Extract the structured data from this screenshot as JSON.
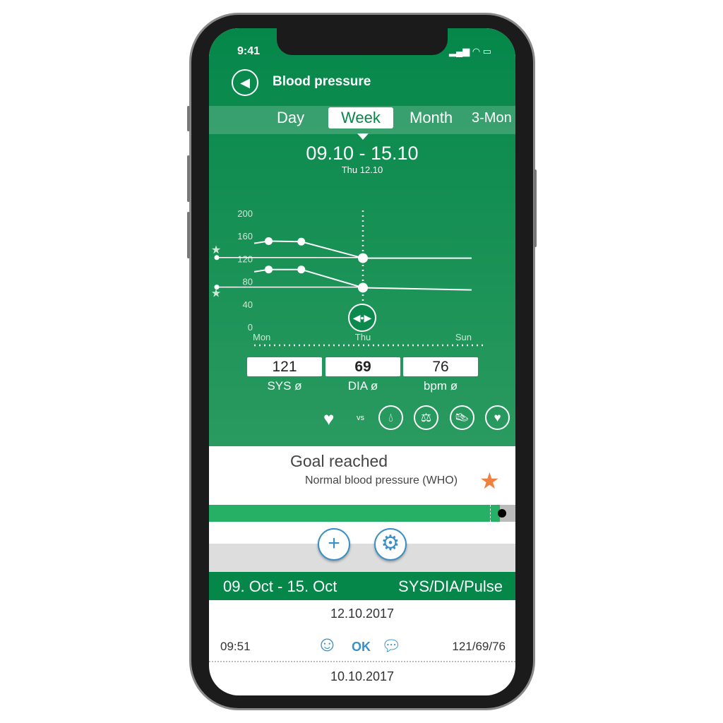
{
  "status": {
    "time": "9:41"
  },
  "header": {
    "title": "Blood pressure"
  },
  "tabs": [
    {
      "label": "Day"
    },
    {
      "label": "Week",
      "active": true
    },
    {
      "label": "Month"
    },
    {
      "label": "3-Mon"
    }
  ],
  "range": {
    "title": "09.10 - 15.10",
    "selected": "Thu 12.10"
  },
  "chart_data": {
    "type": "line",
    "x_labels": [
      "Mon",
      "Thu",
      "Sun"
    ],
    "y_ticks": [
      0,
      40,
      80,
      120,
      160,
      200
    ],
    "ylim": [
      0,
      200
    ],
    "xlim": [
      0,
      6
    ],
    "series": [
      {
        "x": [
          0,
          0.4,
          1.3,
          3,
          6
        ],
        "values": [
          147,
          151,
          150,
          121,
          121
        ]
      },
      {
        "x": [
          0,
          0.4,
          1.3,
          3,
          6
        ],
        "values": [
          97,
          101,
          101,
          69,
          65
        ]
      }
    ],
    "goal_lines": [
      122,
      70
    ]
  },
  "averages": [
    {
      "value": "121",
      "label": "SYS ø"
    },
    {
      "value": "69",
      "label": "DIA ø"
    },
    {
      "value": "76",
      "label": "bpm ø"
    }
  ],
  "compare": {
    "vs": "vs",
    "icons": [
      "heart-pulse-icon",
      "drop-icon",
      "scale-icon",
      "shoe-icon",
      "heart-icon"
    ]
  },
  "goal": {
    "title": "Goal reached",
    "subtitle": "Normal blood pressure (WHO)",
    "progress": 0.95,
    "bar_color": "#25b066"
  },
  "list": {
    "range": "09. Oct - 15. Oct",
    "columns": "SYS/DIA/Pulse",
    "entries": [
      {
        "date": "12.10.2017",
        "time": "09:51",
        "status": "OK",
        "value": "121/69/76"
      },
      {
        "date": "10.10.2017"
      }
    ]
  },
  "colors": {
    "primary": "#05874a",
    "accent": "#3a8fc7"
  }
}
